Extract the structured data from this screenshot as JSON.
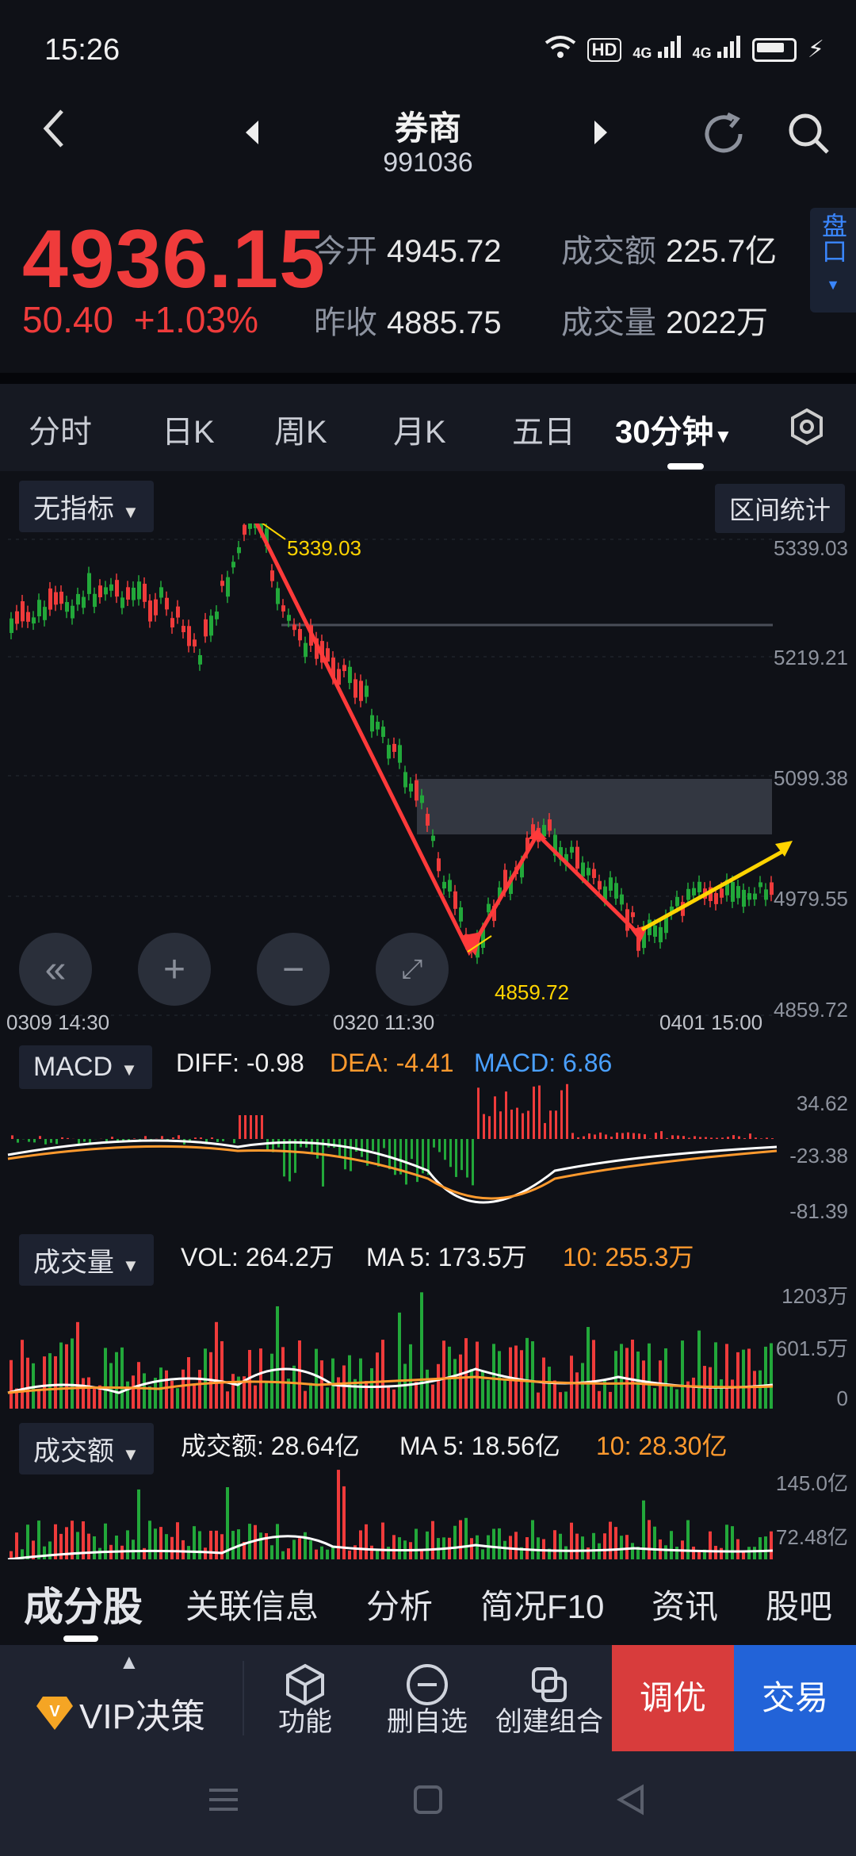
{
  "status": {
    "time": "15:26",
    "hd": "HD",
    "net1": "4G",
    "net2": "4G"
  },
  "header": {
    "title": "券商",
    "code": "991036"
  },
  "quote": {
    "price": "4936.15",
    "change": "50.40",
    "change_pct": "+1.03%",
    "open_label": "今开",
    "open": "4945.72",
    "prev_close_label": "昨收",
    "prev_close": "4885.75",
    "turnover_label": "成交额",
    "turnover": "225.7亿",
    "volume_label": "成交量",
    "volume": "2022万",
    "pankou": "盘口"
  },
  "period_tabs": [
    "分时",
    "日K",
    "周K",
    "月K",
    "五日",
    "30分钟"
  ],
  "indicator_select": "无指标",
  "range_stats": "区间统计",
  "main_chart": {
    "y_ticks": [
      "5339.03",
      "5219.21",
      "5099.38",
      "4979.55",
      "4859.72"
    ],
    "x_ticks": [
      "0309  14:30",
      "0320  11:30",
      "0401  15:00"
    ],
    "high_label": "5339.03",
    "low_label": "4859.72"
  },
  "macd": {
    "select": "MACD",
    "diff": "DIFF: -0.98",
    "dea": "DEA: -4.41",
    "macd": "MACD: 6.86",
    "y_ticks": [
      "34.62",
      "-23.38",
      "-81.39"
    ]
  },
  "vol": {
    "select": "成交量",
    "vol": "VOL: 264.2万",
    "ma5": "MA 5: 173.5万",
    "ma10": "10: 255.3万",
    "y_ticks": [
      "1203万",
      "601.5万",
      "0"
    ]
  },
  "amt": {
    "select": "成交额",
    "amt": "成交额: 28.64亿",
    "ma5": "MA 5: 18.56亿",
    "ma10": "10: 28.30亿",
    "y_ticks": [
      "145.0亿",
      "72.48亿"
    ]
  },
  "info_tabs": [
    "成分股",
    "关联信息",
    "分析",
    "简况F10",
    "资讯",
    "股吧"
  ],
  "actions": {
    "vip": "VIP决策",
    "func": "功能",
    "remove": "删自选",
    "combo": "创建组合",
    "tune": "调优",
    "trade": "交易"
  },
  "colors": {
    "up": "#ef3b3b",
    "down": "#22a83a",
    "accent": "#ffd400"
  }
}
